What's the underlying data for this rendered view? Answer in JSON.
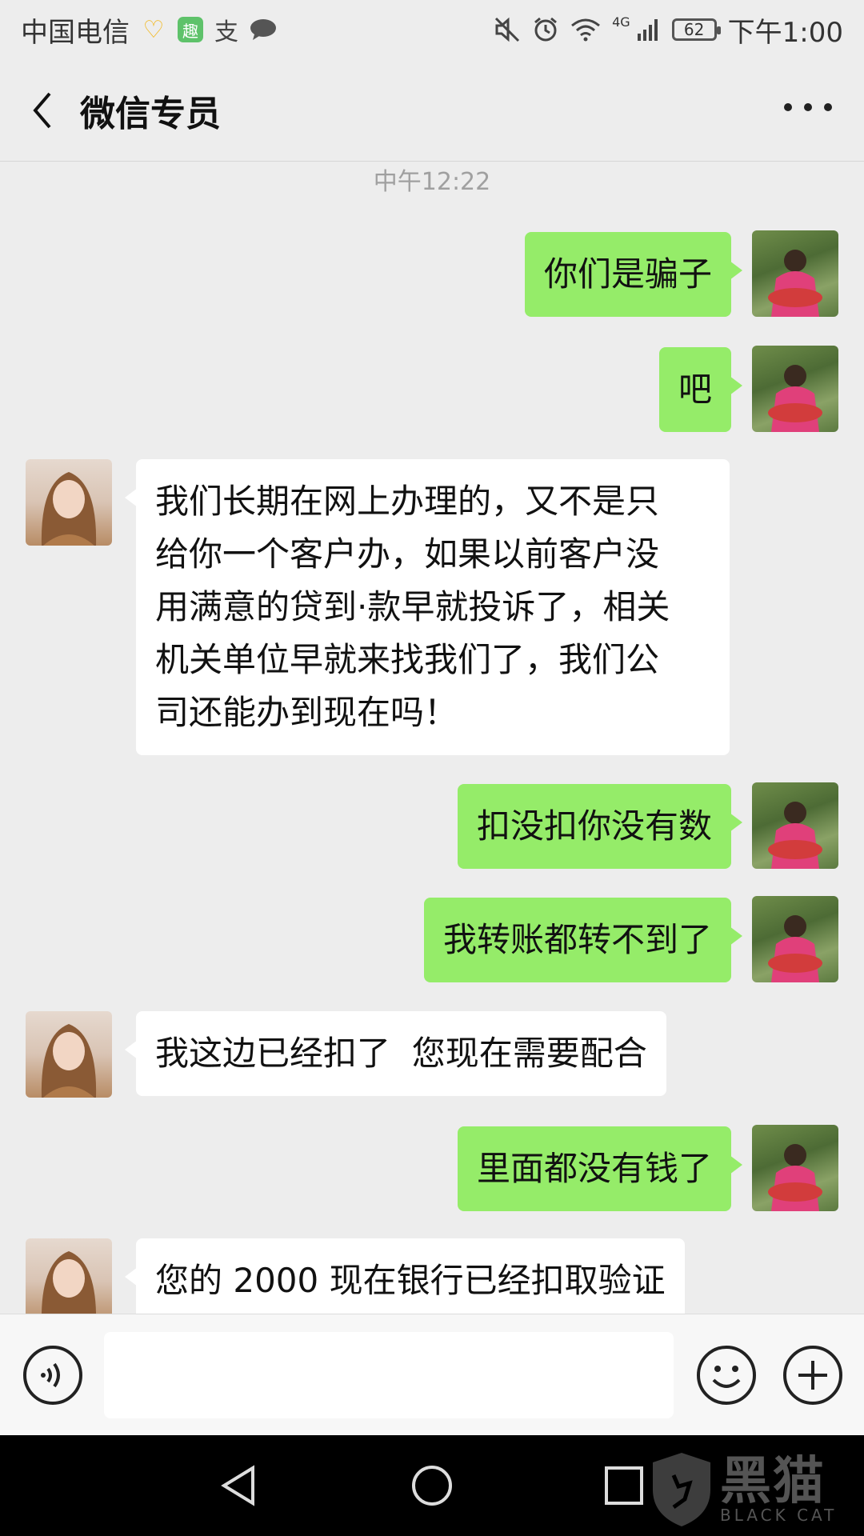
{
  "status_bar": {
    "carrier": "中国电信",
    "network": "4G",
    "battery": "62",
    "time": "下午1:00",
    "icons": [
      "heart-icon",
      "app-icon",
      "pay-icon",
      "chat-icon",
      "mute-icon",
      "alarm-icon",
      "wifi-icon",
      "signal-icon",
      "battery-icon"
    ]
  },
  "header": {
    "title": "微信专员",
    "back_icon": "chevron-left-icon",
    "more_icon": "more-dots-icon"
  },
  "chat": {
    "timestamp": "中午12:22",
    "messages": [
      {
        "sender": "me",
        "text": "你们是骗子"
      },
      {
        "sender": "me",
        "text": "吧"
      },
      {
        "sender": "other",
        "text": "我们长期在网上办理的，又不是只\n给你一个客户办，如果以前客户没\n用满意的贷到·款早就投诉了，相关\n机关单位早就来找我们了，我们公\n司还能办到现在吗！"
      },
      {
        "sender": "me",
        "text": "扣没扣你没有数"
      },
      {
        "sender": "me",
        "text": "我转账都转不到了"
      },
      {
        "sender": "other",
        "text": "我这边已经扣了  您现在需要配合"
      },
      {
        "sender": "me",
        "text": "里面都没有钱了"
      },
      {
        "sender": "other",
        "text": "您的 2000 现在银行已经扣取验证"
      }
    ]
  },
  "input_bar": {
    "voice_icon": "voice-icon",
    "text_value": "",
    "emoji_icon": "emoji-icon",
    "plus_icon": "plus-icon"
  },
  "nav_bar": {
    "back_icon": "nav-back-icon",
    "home_icon": "nav-home-icon",
    "recent_icon": "nav-recent-icon"
  },
  "watermark": {
    "text": "黑猫",
    "subtext": "BLACK CAT"
  },
  "colors": {
    "background": "#ededed",
    "bubble_me": "#95ec69",
    "bubble_other": "#ffffff",
    "nav_bar": "#000000"
  }
}
